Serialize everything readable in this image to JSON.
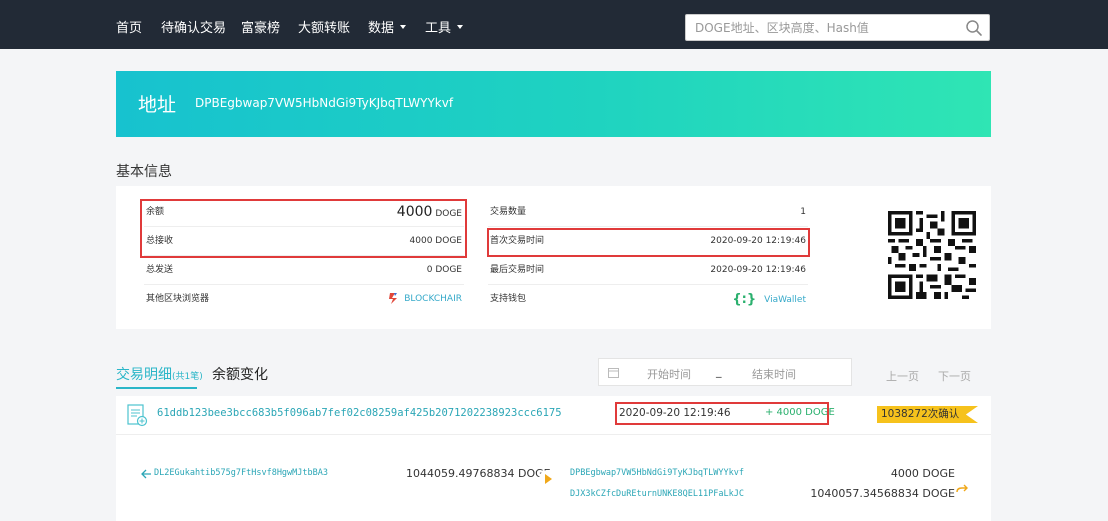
{
  "nav": {
    "items": [
      "首页",
      "待确认交易",
      "富豪榜",
      "大额转账",
      "数据",
      "工具"
    ],
    "search_placeholder": "DOGE地址、区块高度、Hash值"
  },
  "banner": {
    "title": "地址",
    "address": "DPBEgbwap7VW5HbNdGi9TyKJbqTLWYYkvf"
  },
  "basic_info": {
    "title": "基本信息",
    "balance_label": "余额",
    "balance_value": "4000",
    "balance_unit": "DOGE",
    "received_label": "总接收",
    "received_value": "4000 DOGE",
    "sent_label": "总发送",
    "sent_value": "0 DOGE",
    "explorers_label": "其他区块浏览器",
    "explorer_name": "BLOCKCHAIR",
    "tx_count_label": "交易数量",
    "tx_count_value": "1",
    "first_tx_label": "首次交易时间",
    "first_tx_value": "2020-09-20 12:19:46",
    "last_tx_label": "最后交易时间",
    "last_tx_value": "2020-09-20 12:19:46",
    "wallet_label": "支持钱包",
    "wallet_name": "ViaWallet"
  },
  "tabs": {
    "details": "交易明细",
    "details_count": "(共1笔)",
    "balance_change": "余额变化"
  },
  "filter": {
    "start_placeholder": "开始时间",
    "separator": "_",
    "end_placeholder": "结束时间"
  },
  "pager": {
    "prev": "上一页",
    "next": "下一页"
  },
  "transaction": {
    "hash": "61ddb123bee3bcc683b5f096ab7fef02c08259af425b2071202238923ccc6175",
    "time": "2020-09-20 12:19:46",
    "amount": "+ 4000 DOGE",
    "confirmations": "1038272次确认",
    "input_address": "DL2EGukahtib575g7FtHsvf8HgwMJtbBA3",
    "input_amount": "1044059.49768834 DOGE",
    "outputs": [
      {
        "address": "DPBEgbwap7VW5HbNdGi9TyKJbqTLWYYkvf",
        "amount": "4000 DOGE"
      },
      {
        "address": "DJX3kCZfcDuREturnUNKE8QEL11PFaLkJC",
        "amount": "1040057.34568834 DOGE"
      }
    ]
  },
  "colors": {
    "nav_bg": "#222a36",
    "accent": "#2bb6c8",
    "highlight": "#e03a3a",
    "confirm_badge": "#f6c21c",
    "positive": "#2bb06e"
  }
}
